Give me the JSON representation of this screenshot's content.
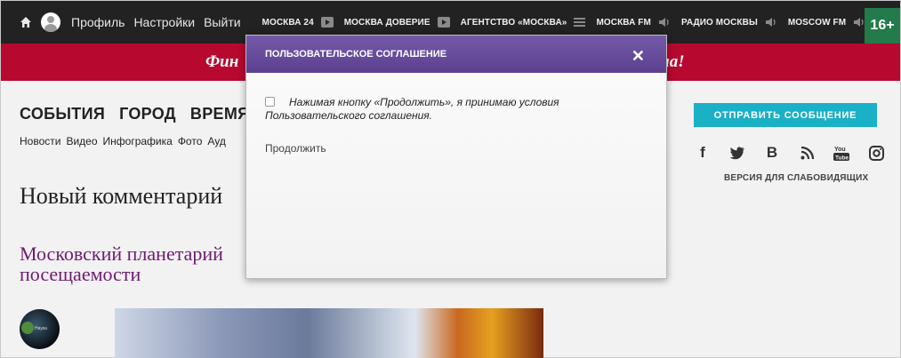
{
  "topbar": {
    "links": [
      "Профиль",
      "Настройки",
      "Выйти"
    ],
    "radios": [
      {
        "label": "МОСКВА 24",
        "icon": "video-icon"
      },
      {
        "label": "МОСКВА ДОВЕРИЕ",
        "icon": "video-icon"
      },
      {
        "label": "АГЕНТСТВО «МОСКВА»",
        "icon": "menu-icon"
      },
      {
        "label": "МОСКВА FM",
        "icon": "speaker-icon"
      },
      {
        "label": "РАДИО МОСКВЫ",
        "icon": "speaker-icon"
      },
      {
        "label": "MOSCOW FM",
        "icon": "speaker-icon"
      }
    ],
    "age_rating": "16+"
  },
  "banner": {
    "left_text": "Фин",
    "right_text": "нала!"
  },
  "nav": {
    "items": [
      "СОБЫТИЯ",
      "ГОРОД",
      "ВРЕМЯ"
    ],
    "sub_items": [
      "Новости",
      "Видео",
      "Инфографика",
      "Фото",
      "Ауд"
    ]
  },
  "page": {
    "headline": "Новый комментарий",
    "article_title": "Московский планетарий посещаемости",
    "thumb_label": "Наука"
  },
  "sidebar": {
    "send_button": "ОТПРАВИТЬ СООБЩЕНИЕ",
    "social_icons": [
      "facebook-icon",
      "twitter-icon",
      "vk-icon",
      "rss-icon",
      "youtube-icon",
      "instagram-icon"
    ],
    "accessible_link": "ВЕРСИЯ ДЛЯ СЛАБОВИДЯЩИХ"
  },
  "modal": {
    "title": "ПОЛЬЗОВАТЕЛЬСКОЕ СОГЛАШЕНИЕ",
    "close": "✕",
    "agreement_text": "Нажимая кнопку «Продолжить», я принимаю условия Пользовательского соглашения.",
    "continue_label": "Продолжить"
  },
  "colors": {
    "accent_purple": "#6a4d9e",
    "banner_red": "#b7082f",
    "button_teal": "#1ab0c6",
    "age_green": "#237a4a"
  }
}
